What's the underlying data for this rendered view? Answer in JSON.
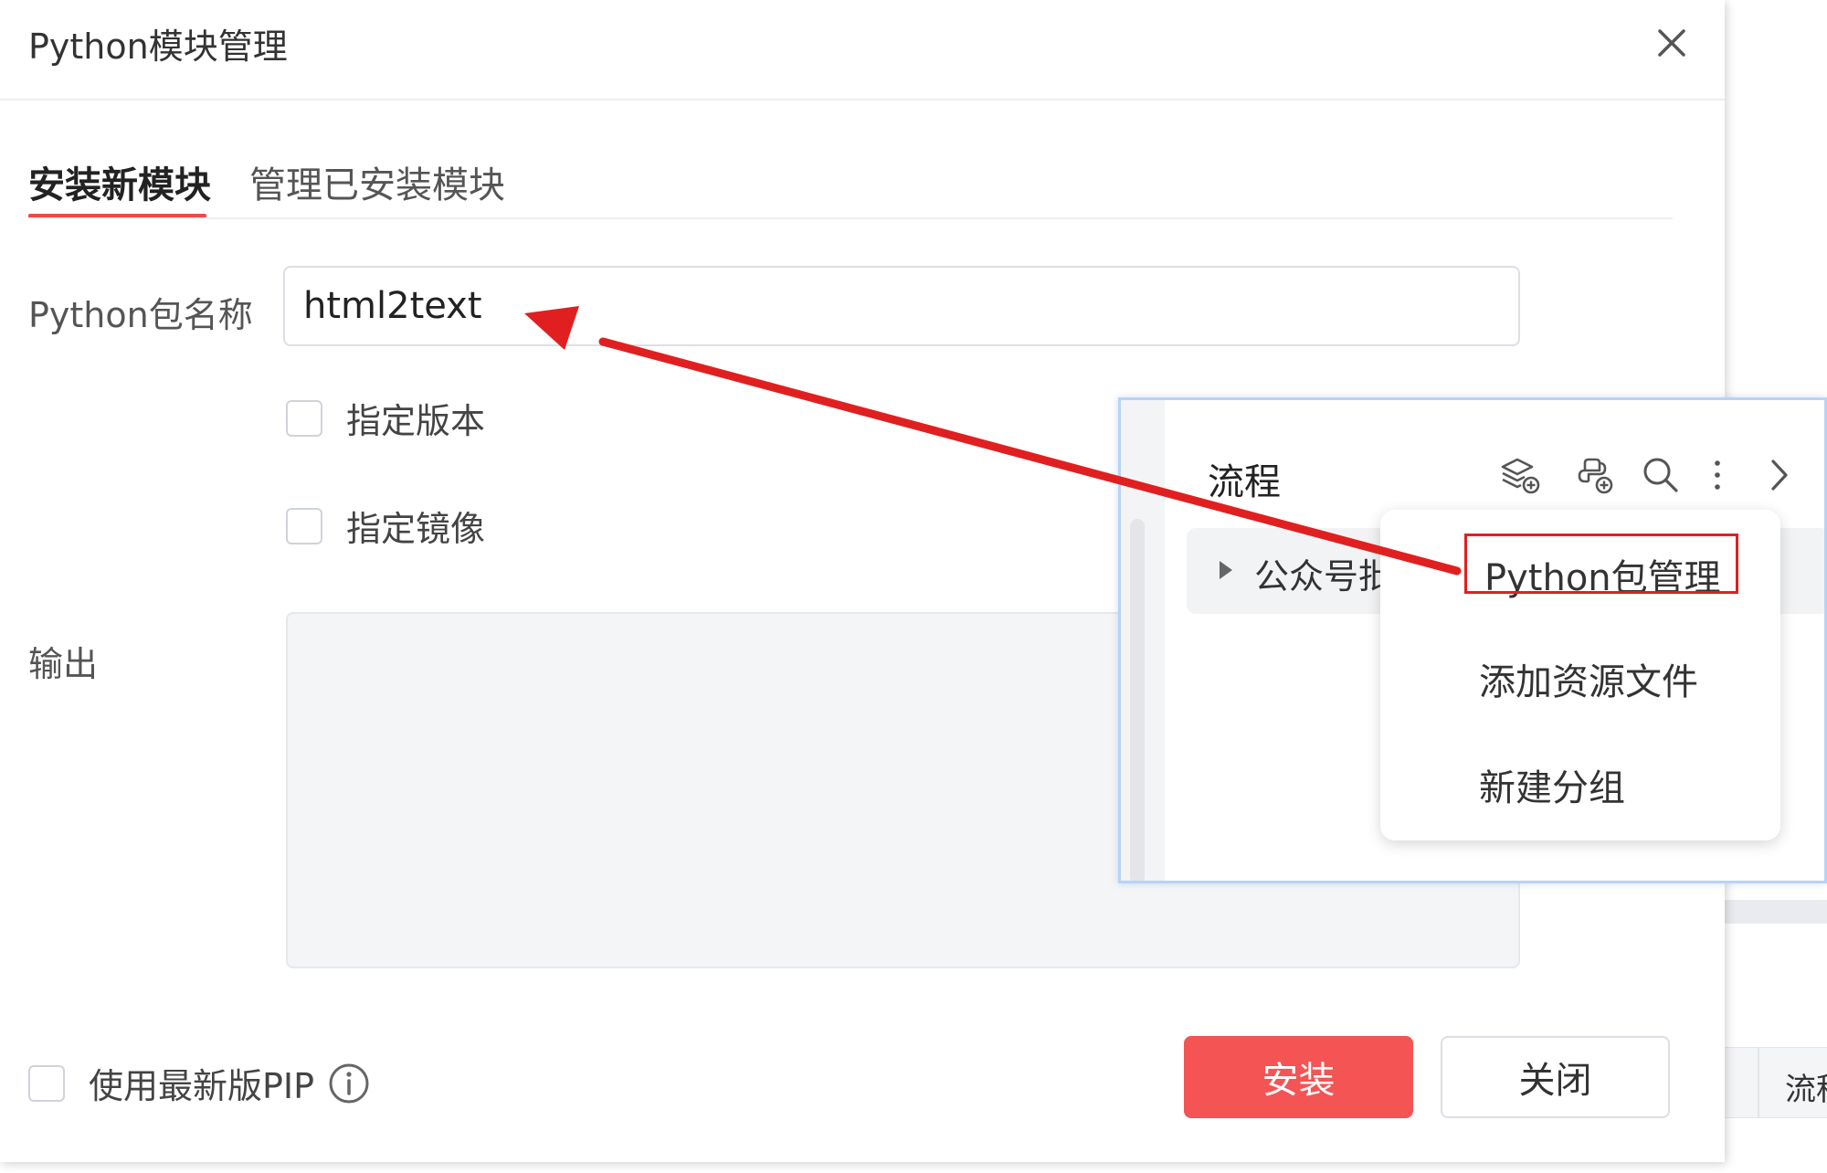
{
  "dialog": {
    "title": "Python模块管理",
    "tabs": [
      {
        "label": "安装新模块",
        "active": true
      },
      {
        "label": "管理已安装模块",
        "active": false
      }
    ],
    "package_label": "Python包名称",
    "package_value": "html2text",
    "checkboxes": [
      {
        "label": "指定版本",
        "checked": false
      },
      {
        "label": "指定镜像",
        "checked": false
      }
    ],
    "output_label": "输出",
    "pip_label": "使用最新版PIP",
    "install_button": "安装",
    "close_button": "关闭"
  },
  "flow_panel": {
    "title": "流程",
    "row_label": "公众号批",
    "toolbar_icons": [
      "add-layer-icon",
      "add-python-icon",
      "search-icon",
      "more-vertical-icon",
      "chevron-right-icon"
    ]
  },
  "context_menu": {
    "items": [
      {
        "label": "Python包管理",
        "highlighted": true
      },
      {
        "label": "添加资源文件",
        "highlighted": false
      },
      {
        "label": "新建分组",
        "highlighted": false
      }
    ]
  },
  "background": {
    "header_cell": "流程"
  },
  "colors": {
    "accent": "#f45454",
    "annotation": "#e02020",
    "panel_border": "#b7d3f6"
  }
}
